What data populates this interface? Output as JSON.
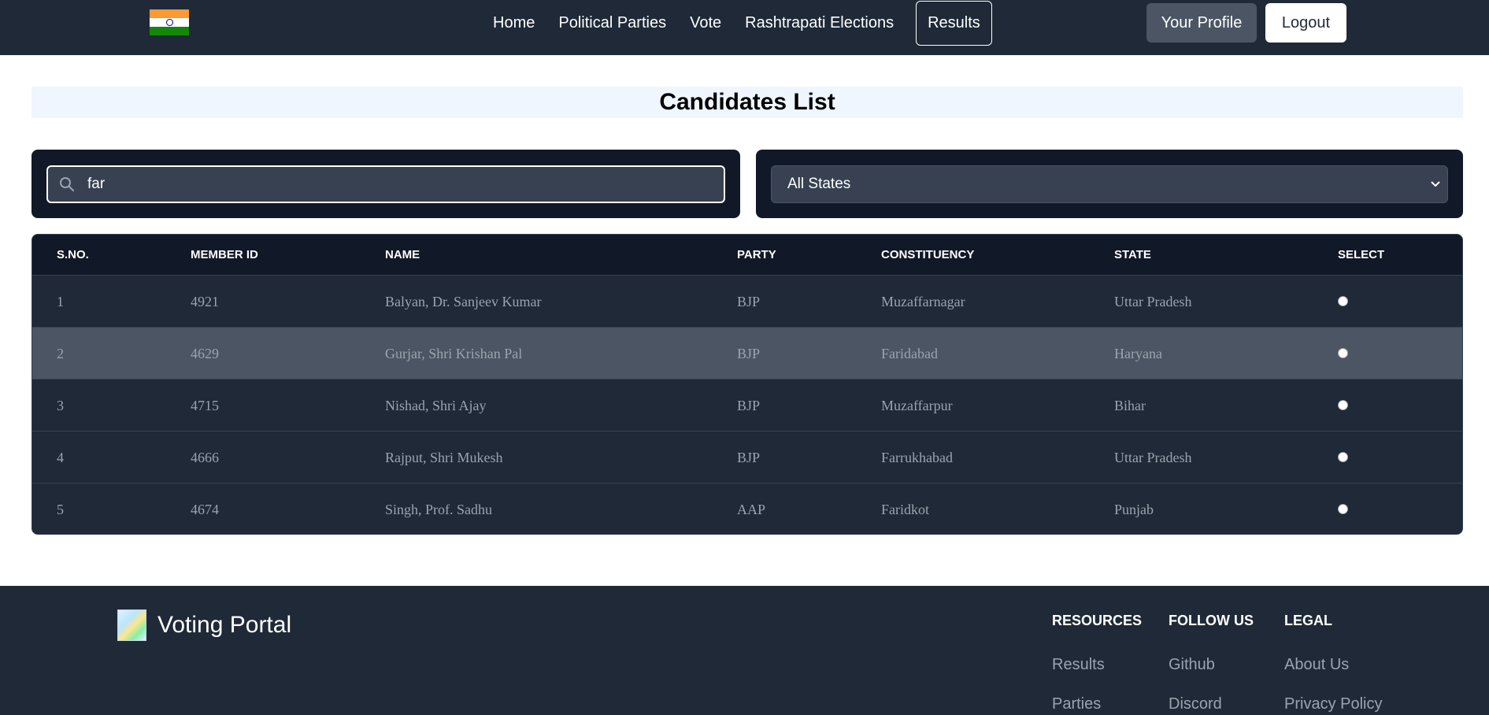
{
  "nav": {
    "links": [
      "Home",
      "Political Parties",
      "Vote",
      "Rashtrapati Elections",
      "Results"
    ],
    "active": "Results",
    "profile_label": "Your Profile",
    "logout_label": "Logout",
    "flag_icon": "india-flag-icon"
  },
  "page": {
    "title": "Candidates List"
  },
  "filters": {
    "search_value": "far",
    "search_icon": "search-icon",
    "state_selected": "All States"
  },
  "table": {
    "headers": [
      "S.NO.",
      "MEMBER ID",
      "NAME",
      "PARTY",
      "CONSTITUENCY",
      "STATE",
      "SELECT"
    ],
    "rows": [
      {
        "sno": "1",
        "id": "4921",
        "name": "Balyan, Dr. Sanjeev Kumar",
        "party": "BJP",
        "constituency": "Muzaffarnagar",
        "state": "Uttar Pradesh"
      },
      {
        "sno": "2",
        "id": "4629",
        "name": "Gurjar, Shri Krishan Pal",
        "party": "BJP",
        "constituency": "Faridabad",
        "state": "Haryana"
      },
      {
        "sno": "3",
        "id": "4715",
        "name": "Nishad, Shri Ajay",
        "party": "BJP",
        "constituency": "Muzaffarpur",
        "state": "Bihar"
      },
      {
        "sno": "4",
        "id": "4666",
        "name": "Rajput, Shri Mukesh",
        "party": "BJP",
        "constituency": "Farrukhabad",
        "state": "Uttar Pradesh"
      },
      {
        "sno": "5",
        "id": "4674",
        "name": "Singh, Prof. Sadhu",
        "party": "AAP",
        "constituency": "Faridkot",
        "state": "Punjab"
      }
    ],
    "hovered_row": 2
  },
  "footer": {
    "brand": "Voting Portal",
    "columns": [
      {
        "heading": "RESOURCES",
        "links": [
          "Results",
          "Parties"
        ]
      },
      {
        "heading": "FOLLOW US",
        "links": [
          "Github",
          "Discord"
        ]
      },
      {
        "heading": "LEGAL",
        "links": [
          "About Us",
          "Privacy Policy"
        ]
      }
    ]
  },
  "colors": {
    "nav_bg": "#1f2937",
    "table_header_bg": "#111827",
    "row_bg": "#1f2937",
    "row_hover_bg": "#4b5563",
    "title_bg": "#eff6ff"
  }
}
